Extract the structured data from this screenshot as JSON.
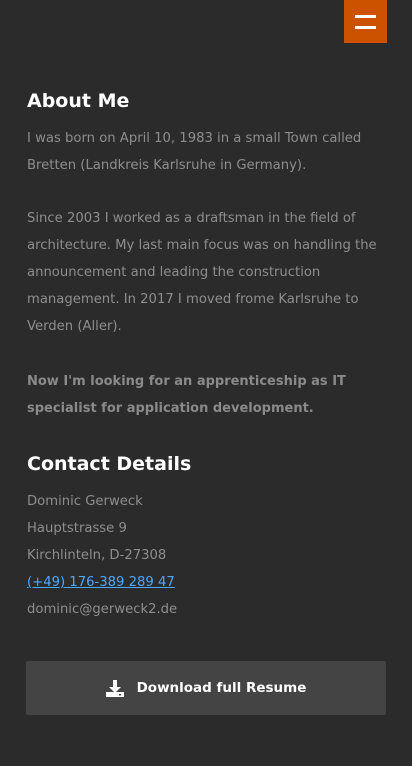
{
  "menu": {
    "icon": "hamburger-menu-icon",
    "accent_color": "#cc5200"
  },
  "about": {
    "title": "About Me",
    "paragraphs": [
      "I was born on April 10, 1983 in a small Town called Bretten (Landkreis Karlsruhe in Germany).",
      "Since 2003 I worked as a draftsman in the field of architecture. My last main focus was on handling the announcement and leading the construction management. In 2017 I moved frome Karlsruhe to Verden (Aller).",
      "Now I'm looking for an apprenticeship as IT specialist for application development."
    ]
  },
  "contact": {
    "title": "Contact Details",
    "name": "Dominic Gerweck",
    "street": "Hauptstrasse 9",
    "city": "Kirchlinteln, D-27308",
    "phone": "(+49) 176-389 289 47",
    "email": "dominic@gerweck2.de",
    "link_color": "#4aa8ff"
  },
  "download": {
    "label": "Download full Resume",
    "icon": "download-icon"
  }
}
